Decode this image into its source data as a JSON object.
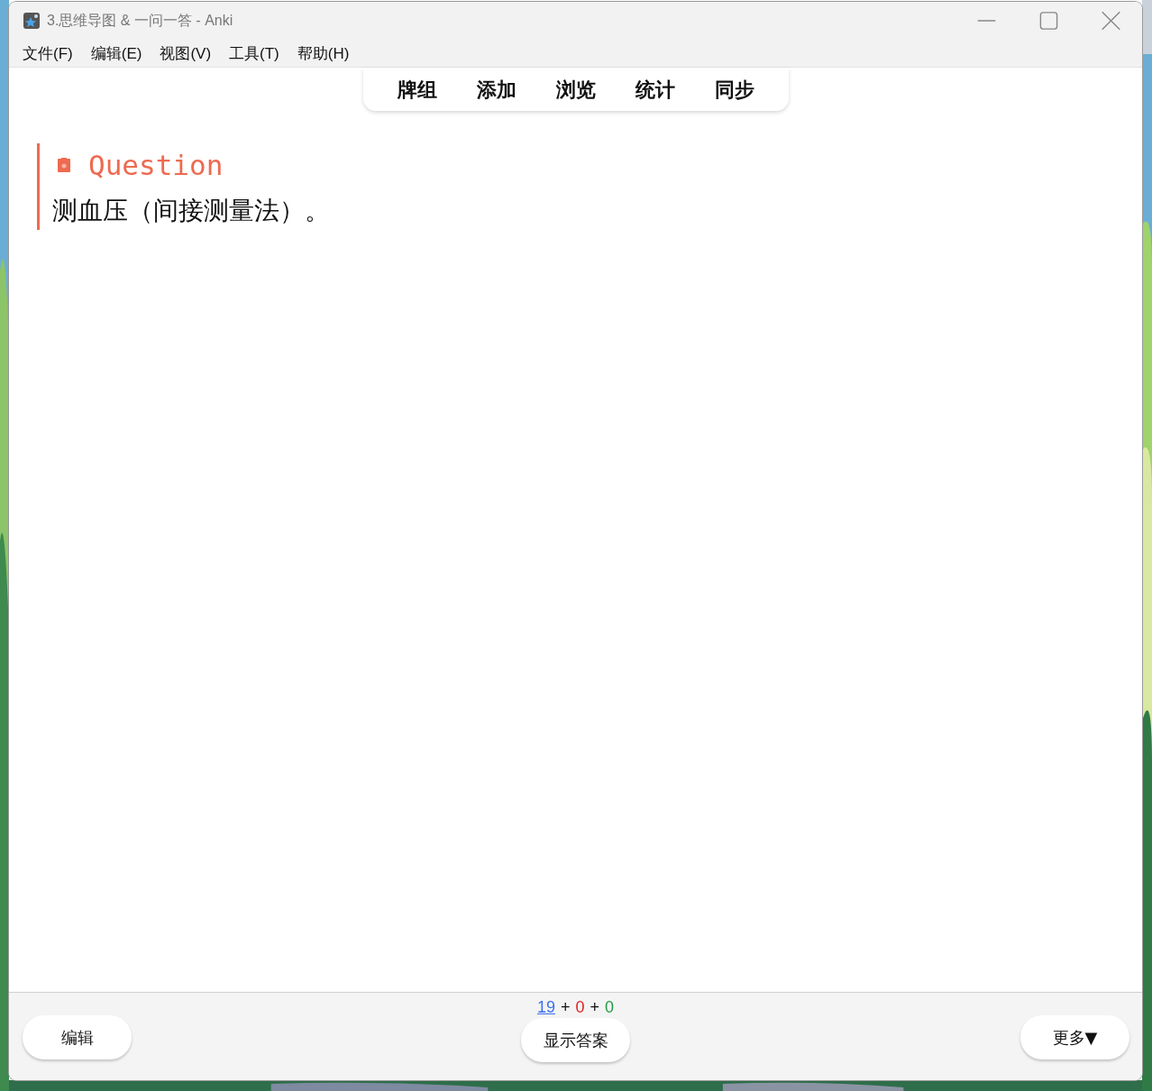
{
  "window": {
    "title": "3.思维导图 & 一问一答 - Anki"
  },
  "menu": [
    "文件(F)",
    "编辑(E)",
    "视图(V)",
    "工具(T)",
    "帮助(H)"
  ],
  "toolbar": [
    "牌组",
    "添加",
    "浏览",
    "统计",
    "同步"
  ],
  "card": {
    "heading": "Question",
    "text": "测血压（间接测量法）。"
  },
  "counts": [
    {
      "value": "19",
      "color": "#3b6ff0",
      "link": true
    },
    {
      "value": "0",
      "color": "#e02020",
      "link": false
    },
    {
      "value": "0",
      "color": "#1f9a3c",
      "link": false
    }
  ],
  "count_separator": "+",
  "buttons": [
    {
      "label": "编辑"
    },
    {
      "label": "显示答案"
    },
    {
      "label": "更多▼"
    }
  ]
}
